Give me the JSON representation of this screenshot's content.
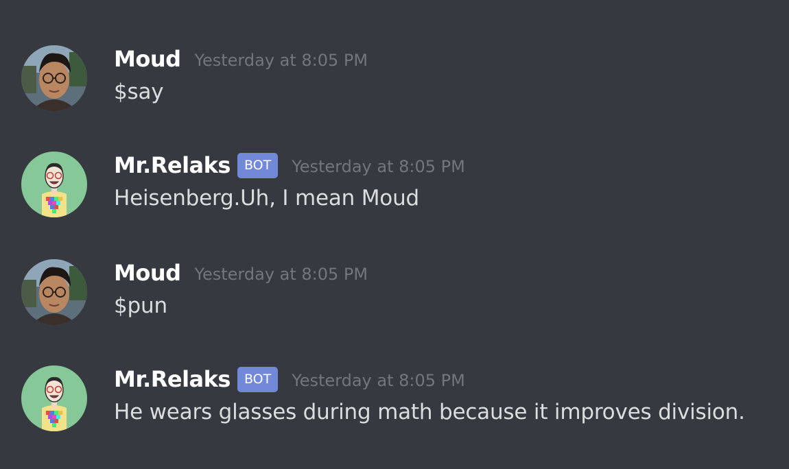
{
  "messages": [
    {
      "author": "Moud",
      "is_bot": false,
      "timestamp": "Yesterday at 8:05 PM",
      "content": "$say",
      "avatar_icon": "human-photo-avatar"
    },
    {
      "author": "Mr.Relaks",
      "is_bot": true,
      "bot_tag": "BOT",
      "timestamp": "Yesterday at 8:05 PM",
      "content": "Heisenberg.Uh, I mean Moud",
      "avatar_icon": "cartoon-bot-avatar"
    },
    {
      "author": "Moud",
      "is_bot": false,
      "timestamp": "Yesterday at 8:05 PM",
      "content": "$pun",
      "avatar_icon": "human-photo-avatar"
    },
    {
      "author": "Mr.Relaks",
      "is_bot": true,
      "bot_tag": "BOT",
      "timestamp": "Yesterday at 8:05 PM",
      "content": "He wears glasses during math because it improves division.",
      "avatar_icon": "cartoon-bot-avatar"
    }
  ],
  "colors": {
    "background": "#36393f",
    "username": "#ffffff",
    "message_text": "#dcddde",
    "timestamp": "#72767d",
    "bot_tag": "#7289da",
    "bot_avatar_bg": "#86c897"
  }
}
